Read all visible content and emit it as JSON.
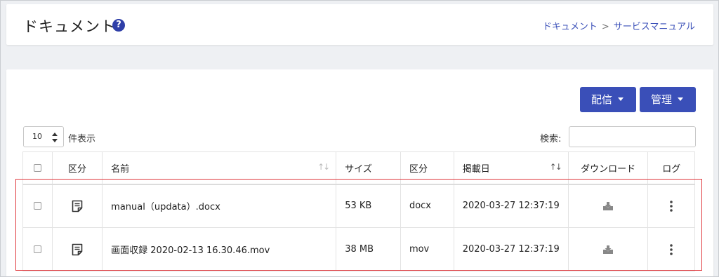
{
  "header": {
    "title": "ドキュメント",
    "help_icon": "question-circle-icon",
    "breadcrumb": {
      "root": "ドキュメント",
      "separator": ">",
      "current": "サービスマニュアル"
    }
  },
  "toolbar": {
    "distribute_label": "配信",
    "manage_label": "管理"
  },
  "list_controls": {
    "page_length": "10",
    "page_length_label": "件表示",
    "search_label": "検索:",
    "search_value": ""
  },
  "table": {
    "headers": [
      "区分",
      "名前",
      "サイズ",
      "区分",
      "掲載日",
      "ダウンロード",
      "ログ"
    ],
    "rows": [
      {
        "name": "manual（updata）.docx",
        "size": "53 KB",
        "type": "docx",
        "date": "2020-03-27 12:37:19"
      },
      {
        "name": "画面収録 2020-02-13 16.30.46.mov",
        "size": "38 MB",
        "type": "mov",
        "date": "2020-03-27 12:37:19"
      }
    ]
  },
  "colors": {
    "accent": "#3a4fb8",
    "highlight": "#e0393e"
  }
}
